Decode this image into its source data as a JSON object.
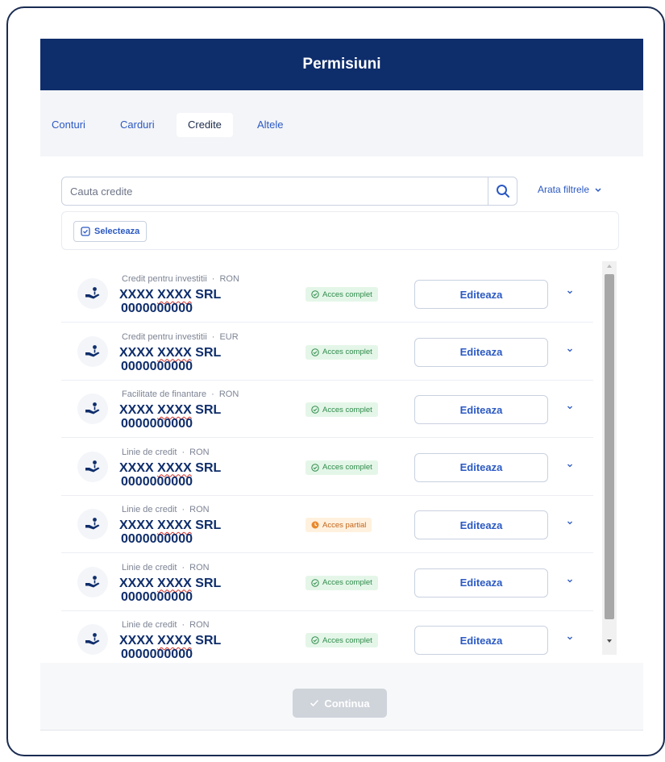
{
  "header": {
    "title": "Permisiuni"
  },
  "tabs": [
    {
      "label": "Conturi",
      "active": false
    },
    {
      "label": "Carduri",
      "active": false
    },
    {
      "label": "Credite",
      "active": true
    },
    {
      "label": "Altele",
      "active": false
    }
  ],
  "search": {
    "placeholder": "Cauta credite",
    "value": "",
    "icon": "search-icon"
  },
  "filters": {
    "label": "Arata filtrele",
    "icon": "chevron-down-icon"
  },
  "select_button": {
    "label": "Selecteaza",
    "icon": "checkbox-icon"
  },
  "credits": [
    {
      "type": "Credit pentru investitii",
      "currency": "RON",
      "name_plain": "XXXX ",
      "name_underlined": "XXXX",
      "name_suffix": " SRL",
      "account": "0000000000",
      "access": "Acces complet",
      "access_level": "full",
      "edit_label": "Editeaza"
    },
    {
      "type": "Credit pentru investitii",
      "currency": "EUR",
      "name_plain": "XXXX ",
      "name_underlined": "XXXX",
      "name_suffix": " SRL",
      "account": "0000000000",
      "access": "Acces complet",
      "access_level": "full",
      "edit_label": "Editeaza"
    },
    {
      "type": "Facilitate de finantare",
      "currency": "RON",
      "name_plain": "XXXX ",
      "name_underlined": "XXXX",
      "name_suffix": " SRL",
      "account": "0000000000",
      "access": "Acces complet",
      "access_level": "full",
      "edit_label": "Editeaza"
    },
    {
      "type": "Linie de credit",
      "currency": "RON",
      "name_plain": "XXXX ",
      "name_underlined": "XXXX",
      "name_suffix": " SRL",
      "account": "0000000000",
      "access": "Acces complet",
      "access_level": "full",
      "edit_label": "Editeaza"
    },
    {
      "type": "Linie de credit",
      "currency": "RON",
      "name_plain": "XXXX ",
      "name_underlined": "XXXX",
      "name_suffix": " SRL",
      "account": "0000000000",
      "access": "Acces partial",
      "access_level": "partial",
      "edit_label": "Editeaza"
    },
    {
      "type": "Linie de credit",
      "currency": "RON",
      "name_plain": "XXXX ",
      "name_underlined": "XXXX",
      "name_suffix": " SRL",
      "account": "0000000000",
      "access": "Acces complet",
      "access_level": "full",
      "edit_label": "Editeaza"
    },
    {
      "type": "Linie de credit",
      "currency": "RON",
      "name_plain": "XXXX ",
      "name_underlined": "XXXX",
      "name_suffix": " SRL",
      "account": "0000000000",
      "access": "Acces complet",
      "access_level": "full",
      "edit_label": "Editeaza"
    }
  ],
  "separator": "·",
  "footer": {
    "continue_label": "Continua",
    "continue_enabled": false
  },
  "colors": {
    "header_bg": "#0e2d6b",
    "accent": "#2b59c3",
    "full_access_bg": "#e4f6e8",
    "full_access_text": "#2e8b4a",
    "partial_access_bg": "#fff1de",
    "partial_access_text": "#c2651a"
  }
}
